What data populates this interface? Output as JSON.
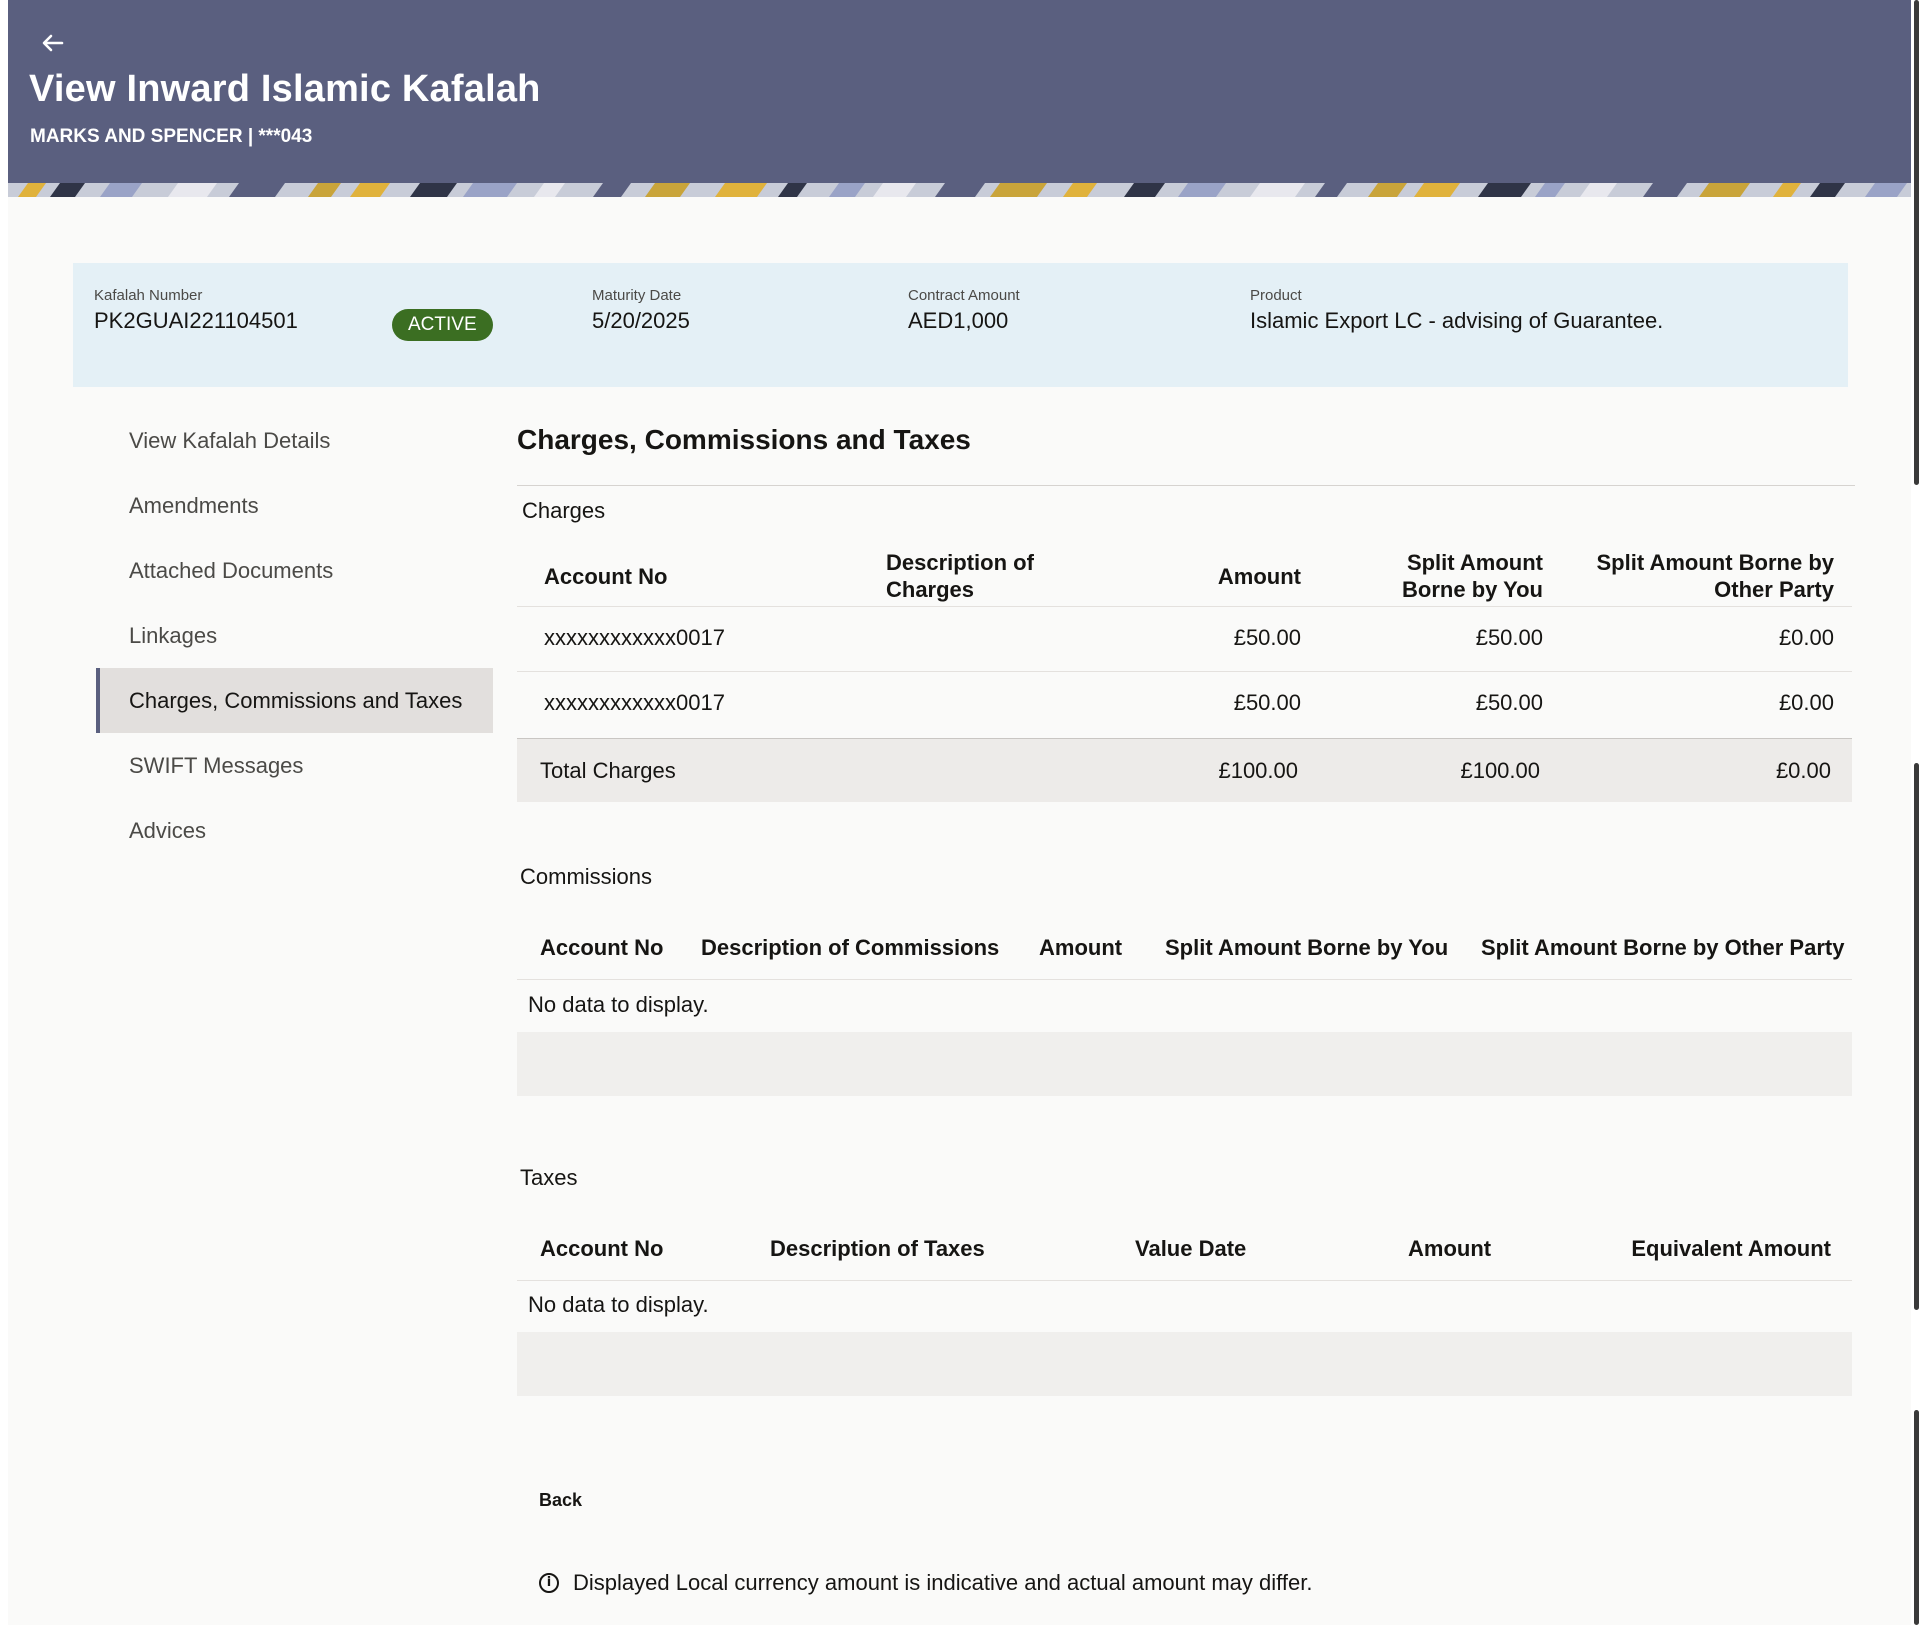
{
  "header": {
    "title": "View Inward Islamic Kafalah",
    "subtitle": "MARKS AND SPENCER | ***043",
    "back_icon": "arrow-left-icon"
  },
  "summary": {
    "kafalah_number_label": "Kafalah Number",
    "kafalah_number": "PK2GUAI221104501",
    "status": "ACTIVE",
    "maturity_date_label": "Maturity Date",
    "maturity_date": "5/20/2025",
    "contract_amount_label": "Contract Amount",
    "contract_amount": "AED1,000",
    "product_label": "Product",
    "product": "Islamic Export LC - advising of Guarantee."
  },
  "sidenav": {
    "items": [
      {
        "label": "View Kafalah Details"
      },
      {
        "label": "Amendments"
      },
      {
        "label": "Attached Documents"
      },
      {
        "label": "Linkages"
      },
      {
        "label": "Charges, Commissions and Taxes",
        "active": true
      },
      {
        "label": "SWIFT Messages"
      },
      {
        "label": "Advices"
      }
    ]
  },
  "main": {
    "heading": "Charges, Commissions and Taxes",
    "charges": {
      "title": "Charges",
      "columns": [
        "Account No",
        "Description of Charges",
        "Amount",
        "Split Amount Borne by You",
        "Split Amount Borne by Other Party"
      ],
      "rows": [
        {
          "account": "xxxxxxxxxxxx0017",
          "description": "",
          "amount": "£50.00",
          "you": "£50.00",
          "other": "£0.00"
        },
        {
          "account": "xxxxxxxxxxxx0017",
          "description": "",
          "amount": "£50.00",
          "you": "£50.00",
          "other": "£0.00"
        }
      ],
      "total": {
        "label": "Total Charges",
        "amount": "£100.00",
        "you": "£100.00",
        "other": "£0.00"
      }
    },
    "commissions": {
      "title": "Commissions",
      "columns": [
        "Account No",
        "Description of Commissions",
        "Amount",
        "Split Amount Borne by You",
        "Split Amount Borne by Other Party"
      ],
      "empty_text": "No data to display."
    },
    "taxes": {
      "title": "Taxes",
      "columns": [
        "Account No",
        "Description of Taxes",
        "Value Date",
        "Amount",
        "Equivalent Amount"
      ],
      "empty_text": "No data to display."
    },
    "back_label": "Back",
    "note": "Displayed Local currency amount is indicative and actual amount may differ.",
    "note_icon": "info-icon"
  },
  "colors": {
    "header_bg": "#5a5f7f",
    "summary_bg": "#e4f0f6",
    "active_badge": "#3b6e22",
    "page_bg": "#fafaf9"
  }
}
